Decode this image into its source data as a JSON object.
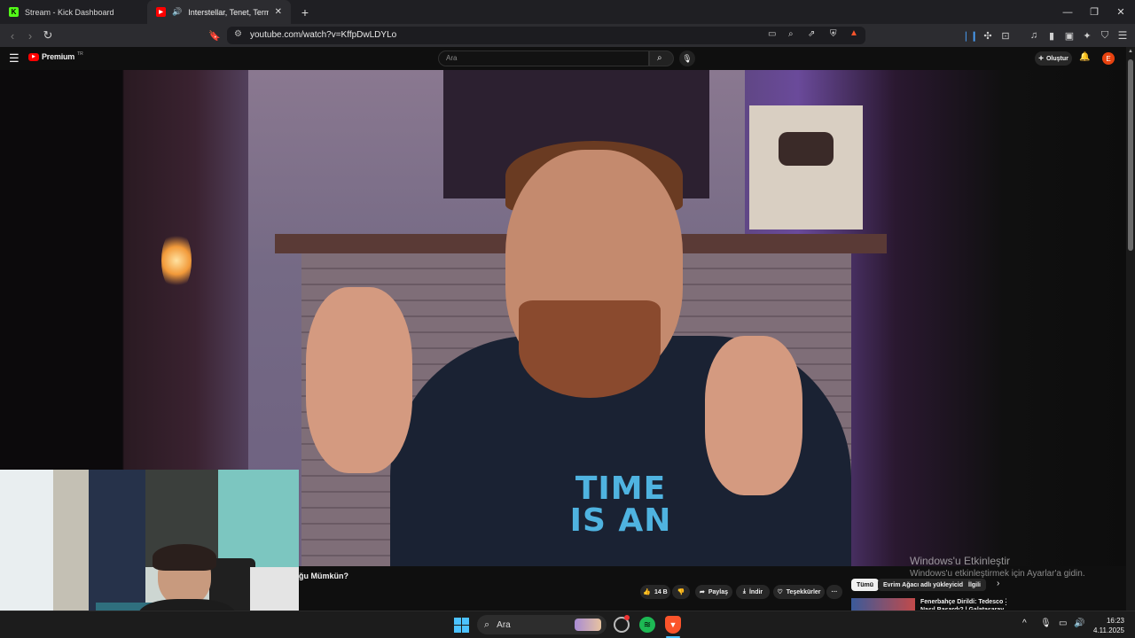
{
  "browser": {
    "tabs": [
      {
        "title": "Stream - Kick Dashboard",
        "icon": "kick-icon",
        "active": false
      },
      {
        "title": "Interstellar, Tenet, Terminator",
        "icon": "youtube-icon",
        "active": true
      }
    ],
    "new_tab_symbol": "+",
    "url": "youtube.com/watch?v=KffpDwLDYLo"
  },
  "youtube": {
    "logo_text": "Premium",
    "premium_superscript": "TR",
    "search_placeholder": "Ara",
    "create_label": "Oluştur",
    "avatar_letter": "E",
    "video_title": "ğu Mümkün?",
    "shirt_text_line1": "TIME",
    "shirt_text_line2": "IS AN",
    "actions": {
      "likes": "14 B",
      "share": "Paylaş",
      "download": "İndir",
      "thanks": "Teşekkürler",
      "more": "···"
    },
    "chips": [
      "Tümü",
      "Evrim Ağacı adlı yükleyiciden",
      "İlgili"
    ],
    "recommended": {
      "title_line1": "Fenerbahçe Dirildi: Tedesco",
      "title_line2": "Nasıl Başardı? | Galatasaray..."
    }
  },
  "windows_activation": {
    "title": "Windows'u Etkinleştir",
    "subtitle": "Windows'u etkinleştirmek için Ayarlar'a gidin."
  },
  "taskbar": {
    "search_label": "Ara",
    "time": "16:23",
    "date": "4.11.2025"
  },
  "colors": {
    "youtube_red": "#ff0000",
    "kick_green": "#53fc18",
    "spotify_green": "#1db954",
    "brave_orange": "#fb542b"
  }
}
